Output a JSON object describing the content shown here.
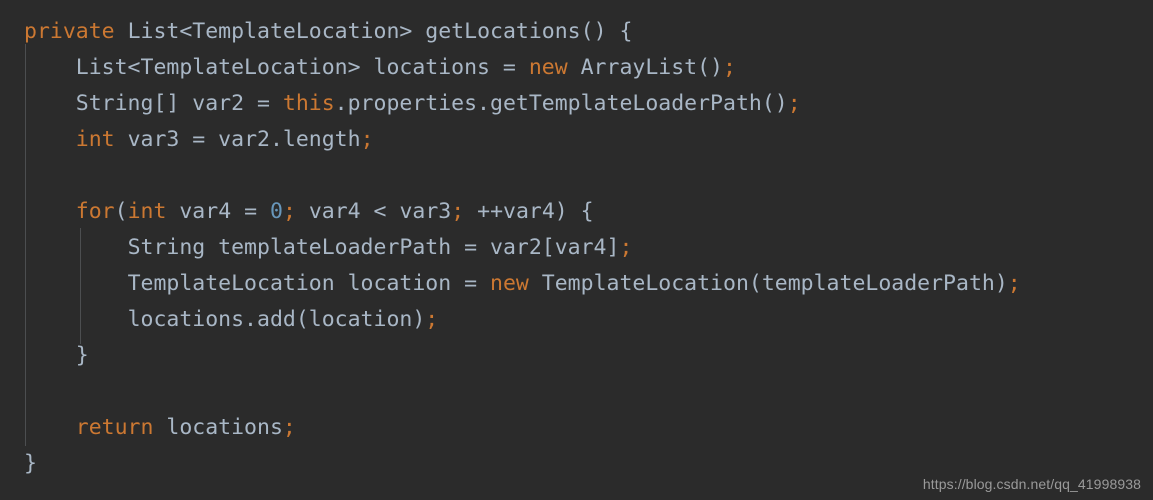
{
  "editor": {
    "language": "java",
    "theme": "darcula",
    "colors": {
      "background": "#2b2b2b",
      "keyword": "#cc7832",
      "identifier": "#a9b7c6",
      "number": "#6897bb",
      "semicolon": "#cc7832",
      "indent_guide": "#585b5d",
      "watermark": "#9a9a9a"
    }
  },
  "code": {
    "lines": [
      {
        "index": 1,
        "text": "private List<TemplateLocation> getLocations() {",
        "tokens": [
          {
            "t": "private",
            "c": "kw"
          },
          {
            "t": " ",
            "c": "id"
          },
          {
            "t": "List<TemplateLocation>",
            "c": "id"
          },
          {
            "t": " ",
            "c": "id"
          },
          {
            "t": "getLocations() {",
            "c": "id"
          }
        ]
      },
      {
        "index": 2,
        "text": "    List<TemplateLocation> locations = new ArrayList();",
        "tokens": [
          {
            "t": "    ",
            "c": "id"
          },
          {
            "t": "List<TemplateLocation> locations = ",
            "c": "id"
          },
          {
            "t": "new",
            "c": "kw"
          },
          {
            "t": " ArrayList()",
            "c": "id"
          },
          {
            "t": ";",
            "c": "semi"
          }
        ]
      },
      {
        "index": 3,
        "text": "    String[] var2 = this.properties.getTemplateLoaderPath();",
        "tokens": [
          {
            "t": "    ",
            "c": "id"
          },
          {
            "t": "String[] var2 = ",
            "c": "id"
          },
          {
            "t": "this",
            "c": "kw"
          },
          {
            "t": ".properties.getTemplateLoaderPath()",
            "c": "id"
          },
          {
            "t": ";",
            "c": "semi"
          }
        ]
      },
      {
        "index": 4,
        "text": "    int var3 = var2.length;",
        "tokens": [
          {
            "t": "    ",
            "c": "id"
          },
          {
            "t": "int",
            "c": "kw"
          },
          {
            "t": " var3 = var2.length",
            "c": "id"
          },
          {
            "t": ";",
            "c": "semi"
          }
        ]
      },
      {
        "index": 5,
        "text": "",
        "tokens": []
      },
      {
        "index": 6,
        "text": "    for(int var4 = 0; var4 < var3; ++var4) {",
        "tokens": [
          {
            "t": "    ",
            "c": "id"
          },
          {
            "t": "for",
            "c": "kw"
          },
          {
            "t": "(",
            "c": "id"
          },
          {
            "t": "int",
            "c": "kw"
          },
          {
            "t": " var4 = ",
            "c": "id"
          },
          {
            "t": "0",
            "c": "num"
          },
          {
            "t": ";",
            "c": "semi"
          },
          {
            "t": " var4 < var3",
            "c": "id"
          },
          {
            "t": ";",
            "c": "semi"
          },
          {
            "t": " ++var4) {",
            "c": "id"
          }
        ]
      },
      {
        "index": 7,
        "text": "        String templateLoaderPath = var2[var4];",
        "tokens": [
          {
            "t": "        ",
            "c": "id"
          },
          {
            "t": "String templateLoaderPath = var2[var4]",
            "c": "id"
          },
          {
            "t": ";",
            "c": "semi"
          }
        ]
      },
      {
        "index": 8,
        "text": "        TemplateLocation location = new TemplateLocation(templateLoaderPath);",
        "tokens": [
          {
            "t": "        ",
            "c": "id"
          },
          {
            "t": "TemplateLocation location = ",
            "c": "id"
          },
          {
            "t": "new",
            "c": "kw"
          },
          {
            "t": " TemplateLocation(templateLoaderPath)",
            "c": "id"
          },
          {
            "t": ";",
            "c": "semi"
          }
        ]
      },
      {
        "index": 9,
        "text": "        locations.add(location);",
        "tokens": [
          {
            "t": "        ",
            "c": "id"
          },
          {
            "t": "locations.add(location)",
            "c": "id"
          },
          {
            "t": ";",
            "c": "semi"
          }
        ]
      },
      {
        "index": 10,
        "text": "    }",
        "tokens": [
          {
            "t": "    ",
            "c": "id"
          },
          {
            "t": "}",
            "c": "brace"
          }
        ]
      },
      {
        "index": 11,
        "text": "",
        "tokens": []
      },
      {
        "index": 12,
        "text": "    return locations;",
        "tokens": [
          {
            "t": "    ",
            "c": "id"
          },
          {
            "t": "return",
            "c": "kw"
          },
          {
            "t": " locations",
            "c": "id"
          },
          {
            "t": ";",
            "c": "semi"
          }
        ]
      },
      {
        "index": 13,
        "text": "}",
        "tokens": [
          {
            "t": "}",
            "c": "brace"
          }
        ]
      }
    ]
  },
  "watermark": {
    "text": "https://blog.csdn.net/qq_41998938"
  }
}
